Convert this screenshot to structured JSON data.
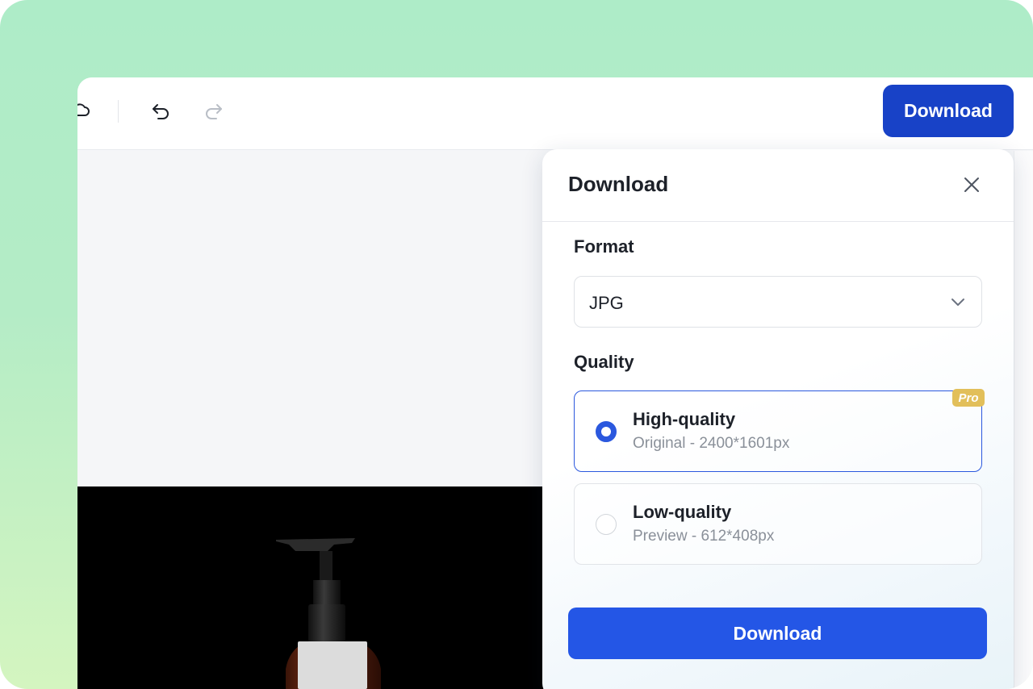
{
  "toolbar": {
    "download_label": "Download",
    "icons": [
      "cloud-icon",
      "undo-icon",
      "redo-icon"
    ]
  },
  "dialog": {
    "title": "Download",
    "format": {
      "label": "Format",
      "selected": "JPG"
    },
    "quality": {
      "label": "Quality",
      "options": [
        {
          "title": "High-quality",
          "subtitle": "Original - 2400*1601px",
          "selected": true,
          "badge": "Pro"
        },
        {
          "title": "Low-quality",
          "subtitle": "Preview - 612*408px",
          "selected": false
        }
      ]
    },
    "download_label": "Download"
  },
  "colors": {
    "primary_dark": "#1842c7",
    "primary": "#2456e6",
    "pro_badge": "#e2bf5a",
    "background_gradient_top": "#aeecc8",
    "background_gradient_bottom": "#d4f5c0"
  }
}
